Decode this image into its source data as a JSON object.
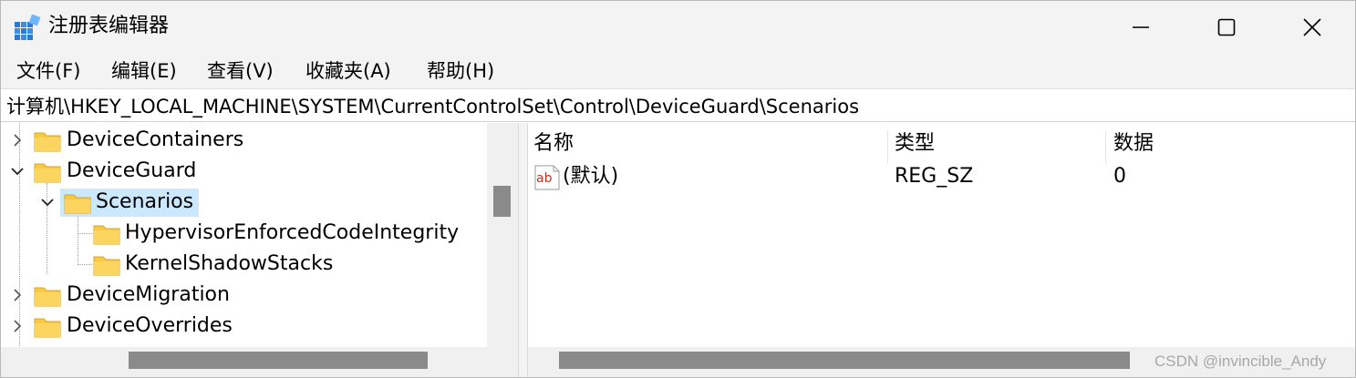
{
  "window": {
    "title": "注册表编辑器",
    "icon": "registry-editor-icon"
  },
  "menu": [
    "文件(F)",
    "编辑(E)",
    "查看(V)",
    "收藏夹(A)",
    "帮助(H)"
  ],
  "address": "计算机\\HKEY_LOCAL_MACHINE\\SYSTEM\\CurrentControlSet\\Control\\DeviceGuard\\Scenarios",
  "tree": {
    "items": [
      {
        "label": "DeviceContainers",
        "expanded": false
      },
      {
        "label": "DeviceGuard",
        "expanded": true
      },
      {
        "label": "Scenarios",
        "expanded": true,
        "selected": true
      },
      {
        "label": "HypervisorEnforcedCodeIntegrity",
        "expanded": false
      },
      {
        "label": "KernelShadowStacks",
        "expanded": false
      },
      {
        "label": "DeviceMigration",
        "expanded": false
      },
      {
        "label": "DeviceOverrides",
        "expanded": false
      }
    ]
  },
  "list": {
    "columns": [
      "名称",
      "类型",
      "数据"
    ],
    "rows": [
      {
        "name": "(默认)",
        "type": "REG_SZ",
        "data": "0",
        "icon": "string-value-icon"
      }
    ]
  },
  "watermark": "CSDN @invincible_Andy",
  "colors": {
    "selection": "#cce8ff",
    "folder": "#f7c948",
    "scroll_thumb": "#8a8a8a"
  }
}
